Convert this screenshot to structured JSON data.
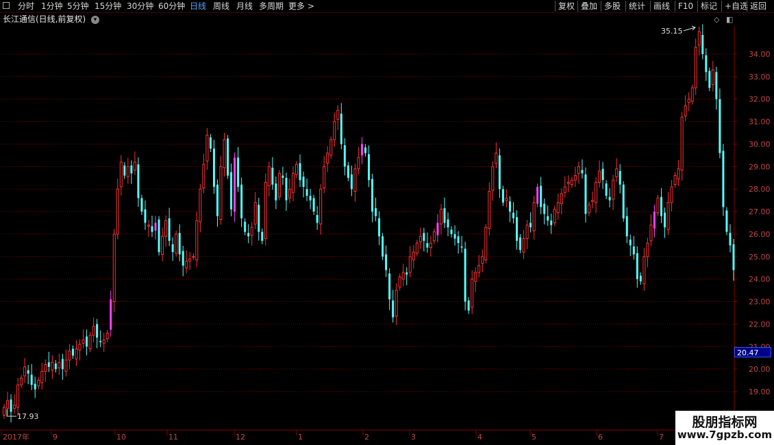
{
  "toolbar": {
    "left": [
      "分时",
      "1分钟",
      "5分钟",
      "15分钟",
      "30分钟",
      "60分钟",
      "日线",
      "周线",
      "月线",
      "多周期",
      "更多 >"
    ],
    "active": "日线",
    "right": [
      "复权",
      "叠加",
      "多股",
      "统计",
      "画线",
      "F10",
      "标记",
      "+自选",
      "返回"
    ]
  },
  "stock_title": "长江通信(日线,前复权)",
  "current_price": "20.47",
  "high_label": "35.15",
  "low_label": "17.93",
  "watermark": {
    "title": "股朋指标网",
    "url": "www.7gpzb.com"
  },
  "colors": {
    "up": "#ff3232",
    "down": "#54ffff",
    "limit": "#ff40ff",
    "grid": "#7a0000",
    "axis_text": "#c84646"
  },
  "chart_data": {
    "type": "candlestick",
    "y_ticks": [
      19.0,
      20.0,
      21.0,
      22.0,
      23.0,
      24.0,
      25.0,
      26.0,
      27.0,
      28.0,
      29.0,
      30.0,
      31.0,
      32.0,
      33.0,
      34.0
    ],
    "x_ticks": [
      "2017年",
      "9",
      "10",
      "11",
      "12",
      "1",
      "2",
      "3",
      "4",
      "5",
      "6",
      "7"
    ],
    "ylim": [
      18.1,
      35.5
    ],
    "closes": [
      18.3,
      18.6,
      18.1,
      18.4,
      19.3,
      19.6,
      20.1,
      19.8,
      19.3,
      19.1,
      19.5,
      19.9,
      20.2,
      20.1,
      20.3,
      20.0,
      20.3,
      20.0,
      20.4,
      20.8,
      20.6,
      20.9,
      21.1,
      21.3,
      21.0,
      21.5,
      21.9,
      21.4,
      21.2,
      21.3,
      21.6,
      23.1,
      26.0,
      28.0,
      29.2,
      28.6,
      29.0,
      28.7,
      29.2,
      27.6,
      27.0,
      26.5,
      26.4,
      26.1,
      26.5,
      25.2,
      25.9,
      26.6,
      25.7,
      25.2,
      26.0,
      25.1,
      24.6,
      24.8,
      24.9,
      25.0,
      26.6,
      28.0,
      29.1,
      30.4,
      29.8,
      28.1,
      26.8,
      29.0,
      30.2,
      28.6,
      27.1,
      29.4,
      28.1,
      26.7,
      26.1,
      25.9,
      26.3,
      27.4,
      26.1,
      25.7,
      28.3,
      29.0,
      28.2,
      27.5,
      28.7,
      28.5,
      27.5,
      28.0,
      28.7,
      29.1,
      28.4,
      28.1,
      27.7,
      27.5,
      27.0,
      26.5,
      28.0,
      29.0,
      29.6,
      30.2,
      31.0,
      31.5,
      30.0,
      29.0,
      28.5,
      28.0,
      28.9,
      29.4,
      30.0,
      29.6,
      28.4,
      27.0,
      26.8,
      25.9,
      25.0,
      24.4,
      23.1,
      22.3,
      23.5,
      24.1,
      24.3,
      24.2,
      25.0,
      25.2,
      25.6,
      25.9,
      25.7,
      25.4,
      25.6,
      26.1,
      26.5,
      27.1,
      26.5,
      26.3,
      26.0,
      25.8,
      25.6,
      25.4,
      23.0,
      22.6,
      24.0,
      24.3,
      24.6,
      25.0,
      26.3,
      27.9,
      29.0,
      29.6,
      28.0,
      27.4,
      27.6,
      27.0,
      26.7,
      25.7,
      25.3,
      25.8,
      26.4,
      26.3,
      27.4,
      28.1,
      27.2,
      26.9,
      26.6,
      26.4,
      27.1,
      27.4,
      27.8,
      28.1,
      28.3,
      28.4,
      28.6,
      29.0,
      28.7,
      26.9,
      27.3,
      27.5,
      28.3,
      28.8,
      28.4,
      27.7,
      27.5,
      28.4,
      28.9,
      28.2,
      26.7,
      25.9,
      25.5,
      25.1,
      24.0,
      23.9,
      25.0,
      25.6,
      26.4,
      27.0,
      27.6,
      26.8,
      26.3,
      27.4,
      28.1,
      28.6,
      28.9,
      31.2,
      31.7,
      32.0,
      32.5,
      34.3,
      35.0,
      34.0,
      33.2,
      32.5,
      33.3,
      32.0,
      29.6,
      27.2,
      26.1,
      25.5,
      24.4
    ]
  }
}
